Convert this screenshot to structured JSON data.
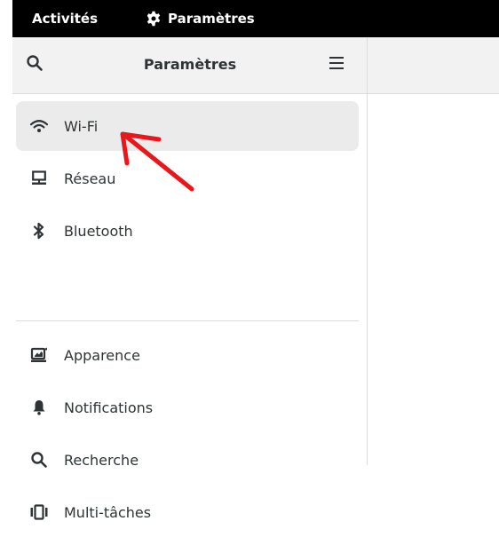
{
  "topbar": {
    "activities_label": "Activités",
    "app_menu_label": "Paramètres",
    "app_menu_icon": "gear-icon"
  },
  "headerbar": {
    "title": "Paramètres",
    "search_icon": "search-icon",
    "menu_icon": "hamburger-menu-icon"
  },
  "sidebar": {
    "items": [
      {
        "label": "Wi-Fi",
        "icon": "wifi-icon",
        "selected": true
      },
      {
        "label": "Réseau",
        "icon": "network-icon"
      },
      {
        "label": "Bluetooth",
        "icon": "bluetooth-icon"
      },
      {
        "label": "Apparence",
        "icon": "appearance-icon"
      },
      {
        "label": "Notifications",
        "icon": "bell-icon"
      },
      {
        "label": "Recherche",
        "icon": "search-icon"
      },
      {
        "label": "Multi-tâches",
        "icon": "multitasking-icon"
      }
    ]
  },
  "annotation": {
    "type": "red-arrow",
    "color": "#e8171c",
    "target": "Wi-Fi"
  },
  "colors": {
    "topbar_bg": "#000000",
    "headerbar_bg": "#f2f2f2",
    "selected_row_bg": "#ebebeb",
    "text": "#2e3436"
  }
}
